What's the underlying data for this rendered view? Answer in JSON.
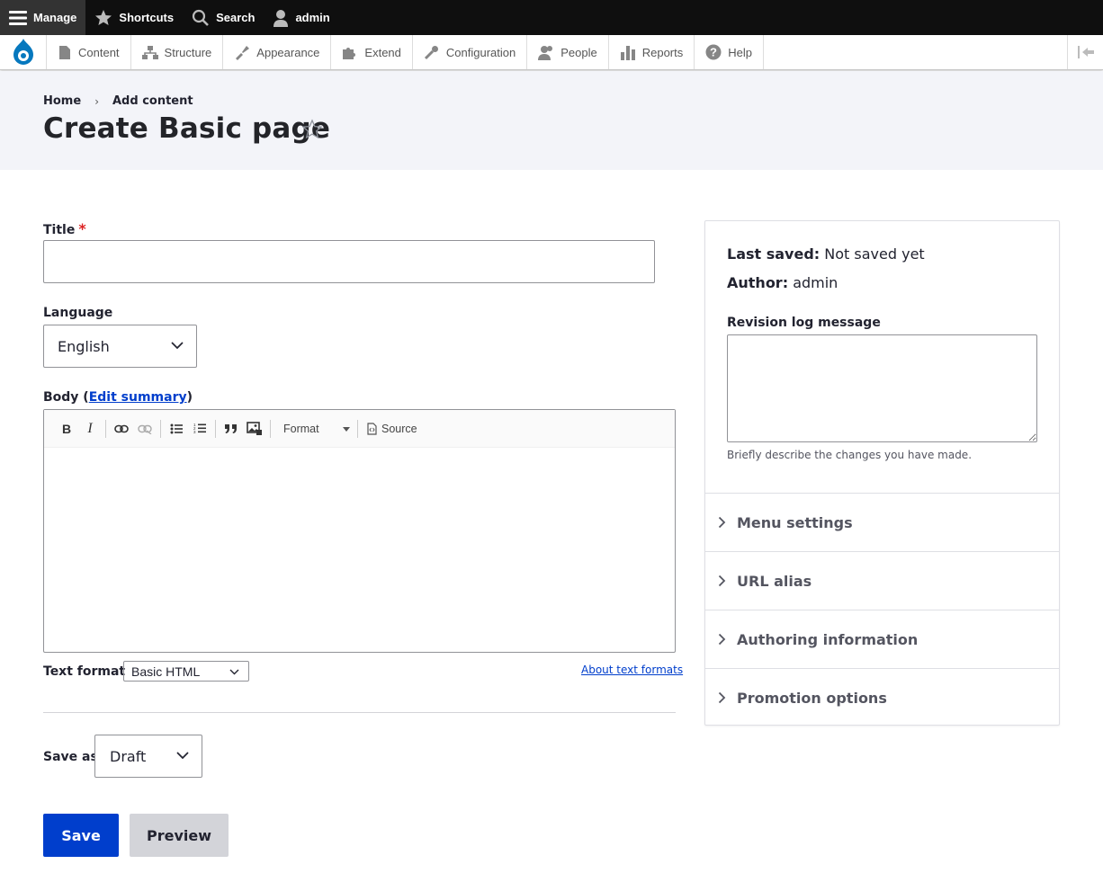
{
  "toolbar": {
    "manage": "Manage",
    "shortcuts": "Shortcuts",
    "search": "Search",
    "user": "admin"
  },
  "tray": {
    "items": [
      "Content",
      "Structure",
      "Appearance",
      "Extend",
      "Configuration",
      "People",
      "Reports",
      "Help"
    ]
  },
  "breadcrumb": {
    "home": "Home",
    "separator": "›",
    "current": "Add content"
  },
  "page": {
    "title": "Create Basic page"
  },
  "form": {
    "title_label": "Title",
    "title_required": "*",
    "title_value": "",
    "language_label": "Language",
    "language_value": "English",
    "body_label_prefix": "Body (",
    "body_edit_summary": "Edit summary",
    "body_label_suffix": ")",
    "editor": {
      "bold": "B",
      "italic": "I",
      "format_label": "Format",
      "source_label": "Source"
    },
    "text_format_label": "Text format",
    "text_format_value": "Basic HTML",
    "about_text_formats": "About text formats",
    "save_as_label": "Save as:",
    "save_as_value": "Draft",
    "save_button": "Save",
    "preview_button": "Preview"
  },
  "sidebar": {
    "last_saved_label": "Last saved:",
    "last_saved_value": "Not saved yet",
    "author_label": "Author:",
    "author_value": "admin",
    "revision_label": "Revision log message",
    "revision_help": "Briefly describe the changes you have made.",
    "sections": [
      "Menu settings",
      "URL alias",
      "Authoring information",
      "Promotion options"
    ]
  },
  "colors": {
    "primary": "#003ecc",
    "toolbar_bg": "#0f0f0f",
    "header_bg": "#f3f4f9",
    "required": "#dc2323"
  }
}
